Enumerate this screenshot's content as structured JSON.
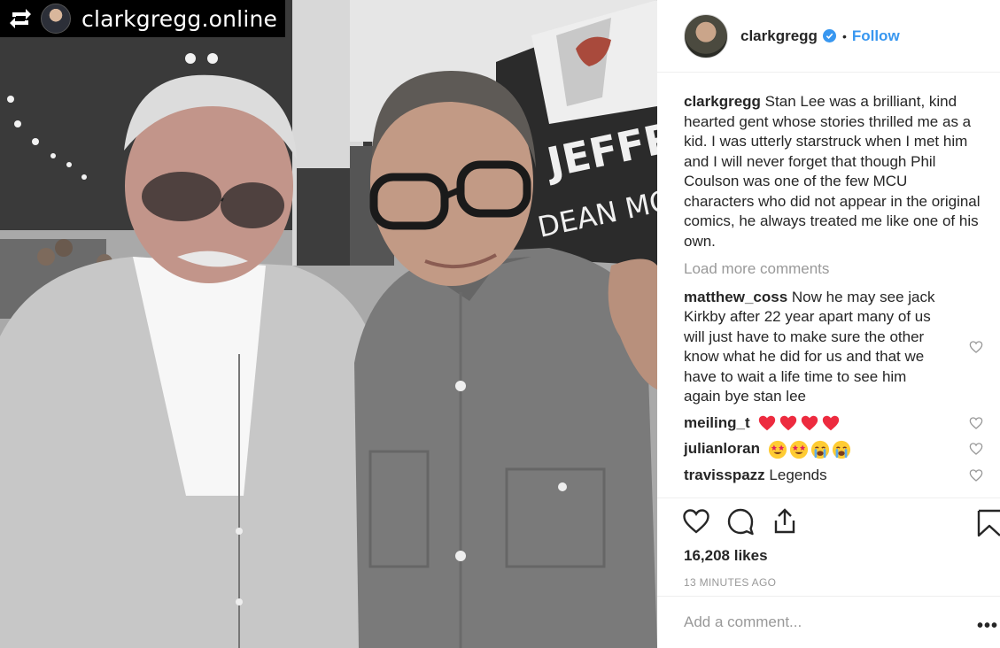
{
  "repost": {
    "handle": "clarkgregg.online"
  },
  "photo": {
    "banner_text_1": "JEFFRE",
    "banner_text_2": "DEAN MORGA"
  },
  "post": {
    "username": "clarkgregg",
    "separator": "•",
    "follow_label": "Follow",
    "caption_user": "clarkgregg",
    "caption_text": "Stan Lee was a brilliant, kind hearted gent whose stories thrilled me as a kid. I was utterly starstruck when I met him and I will never forget that though Phil Coulson was one of the few MCU characters who did not appear in the original comics, he always treated me like one of his own.",
    "load_more": "Load more comments",
    "comments": [
      {
        "user": "matthew_coss",
        "text": "Now he may see jack Kirkby after 22 year apart many of us will just have to make sure the other know what he did for us and that we have to wait a life time to see him again bye stan lee"
      },
      {
        "user": "meiling_t",
        "text": "",
        "emojis": [
          "red-heart",
          "red-heart",
          "red-heart",
          "red-heart"
        ]
      },
      {
        "user": "julianloran",
        "text": "",
        "emojis": [
          "star-struck",
          "star-struck",
          "crying-face",
          "crying-face"
        ]
      },
      {
        "user": "travisspazz",
        "text": "Legends"
      }
    ],
    "likes": "16,208 likes",
    "timestamp": "13 MINUTES AGO",
    "add_comment_placeholder": "Add a comment...",
    "more_options": "•••"
  },
  "colors": {
    "accent": "#3897f0",
    "text": "#262626",
    "muted": "#999999",
    "border": "#efefef",
    "heart_red": "#ed2b3f"
  }
}
